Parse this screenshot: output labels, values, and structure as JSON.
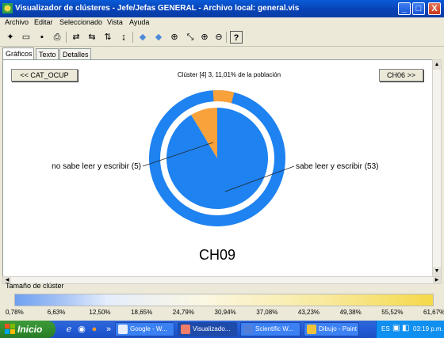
{
  "window": {
    "title": "Visualizador de clústeres - Jefe/Jefas GENERAL - Archivo local: general.vis",
    "minimize": "_",
    "maximize": "□",
    "close": "X"
  },
  "menu": [
    "Archivo",
    "Editar",
    "Seleccionado",
    "Vista",
    "Ayuda"
  ],
  "toolbar": {
    "icons": [
      "new-icon",
      "open-icon",
      "save-icon",
      "print-icon",
      "swap-icon",
      "swap-alt-icon",
      "sort-icon",
      "sort-alt-icon",
      "arrow-left-icon",
      "arrow-right-icon",
      "binoculars-icon",
      "select-icon",
      "zoom-in-icon",
      "zoom-out-icon",
      "help-icon"
    ],
    "glyphs": [
      "✦",
      "▭",
      "▪",
      "⎙",
      "⇄",
      "⇆",
      "⇅",
      "↨",
      "◆",
      "◆",
      "⊕",
      "⤡",
      "⊕",
      "⊖",
      "?"
    ]
  },
  "tabs": [
    "Gráficos",
    "Texto",
    "Detalles"
  ],
  "nav": {
    "prev": "<< CAT_OCUP",
    "next": "CH06 >>"
  },
  "cluster_title": "Clúster [4] 3, 11,01% de la población",
  "chart_data": {
    "type": "pie",
    "title": "CH09",
    "categories": [
      "no sabe leer y escribir",
      "sabe leer y escribir"
    ],
    "values": [
      5,
      53
    ],
    "labels": [
      "no sabe leer y escribir (5)",
      "sabe leer y escribir (53)"
    ],
    "colors": [
      "#f9a13a",
      "#1e82f0"
    ],
    "outer_ring_values": [
      5,
      95
    ]
  },
  "size_legend": {
    "label": "Tamaño de clúster",
    "ticks": [
      "0,78%",
      "6,63%",
      "12,50%",
      "18,65%",
      "24,79%",
      "30,94%",
      "37,08%",
      "43,23%",
      "49,38%",
      "55,52%",
      "61,67%"
    ]
  },
  "taskbar": {
    "start": "Inicio",
    "quicklaunch": [
      "ie-icon",
      "outlook-icon",
      "firefox-icon"
    ],
    "more": "»",
    "tasks": [
      {
        "label": "Google - W...",
        "active": false,
        "color": "#e8eef9"
      },
      {
        "label": "Visualizado...",
        "active": true,
        "color": "#f07c6a"
      },
      {
        "label": "Scientific W...",
        "active": false,
        "color": "#4f7edb"
      },
      {
        "label": "Dibujo - Paint",
        "active": false,
        "color": "#f2c33a"
      }
    ],
    "lang": "ES",
    "clock": "03:19 p.m."
  }
}
